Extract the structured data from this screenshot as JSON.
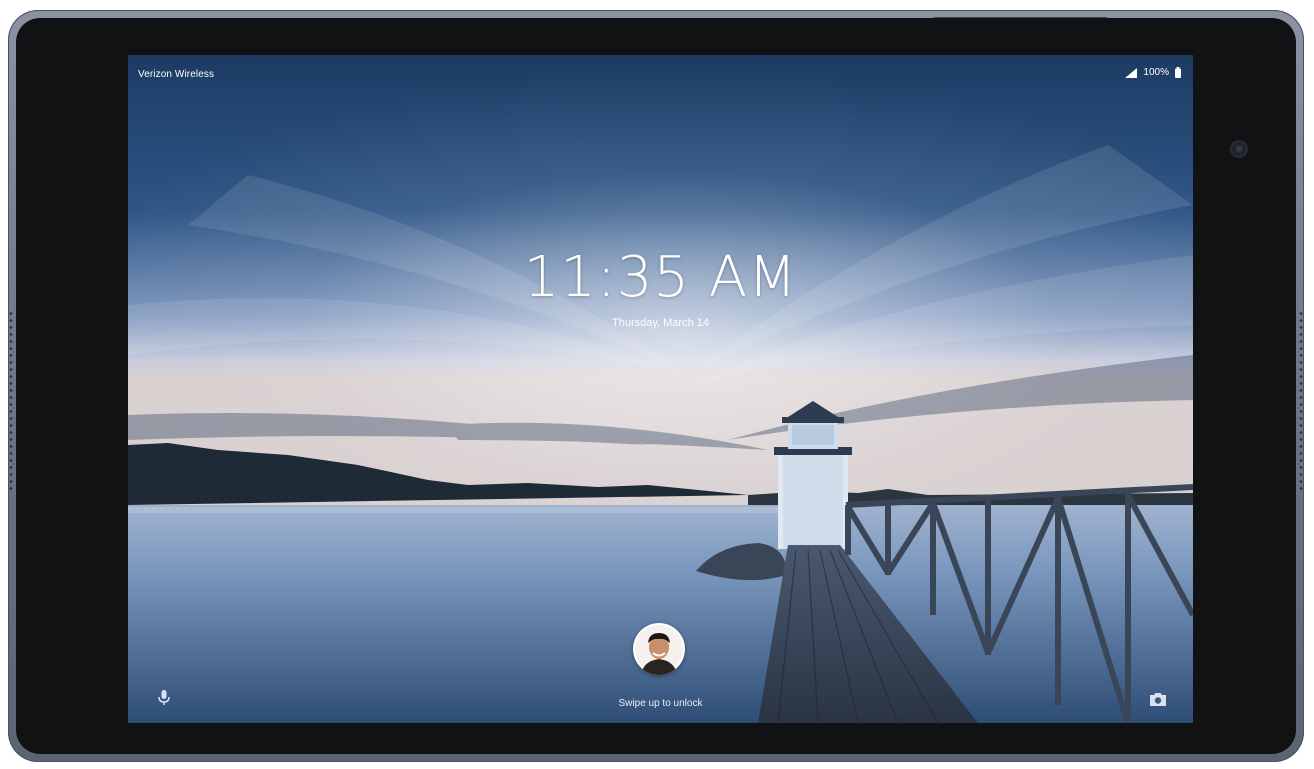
{
  "status_bar": {
    "carrier": "Verizon Wireless",
    "battery_level": "100%",
    "signal_icon": "signal-icon",
    "battery_icon": "battery-icon"
  },
  "lockscreen": {
    "time": "11:35 AM",
    "date": "Thursday, March 14",
    "swipe_hint": "Swipe up to unlock",
    "left_shortcut_icon": "microphone-icon",
    "right_shortcut_icon": "camera-icon",
    "user_avatar_icon": "user-avatar"
  },
  "colors": {
    "text": "#ffffff",
    "sky_top": "#1f3f66",
    "sky_horizon": "#c9cfe0",
    "water": "#6f8fb5",
    "bezel": "#111214",
    "frame": "#7a8393"
  }
}
